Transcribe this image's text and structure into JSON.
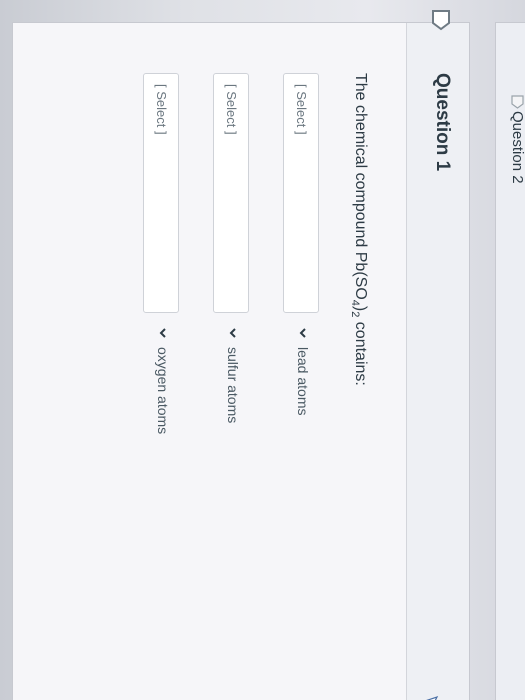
{
  "question1": {
    "title": "Question 1",
    "prompt_prefix": "The chemical compound Pb(SO",
    "prompt_sub1": "4",
    "prompt_mid": ")",
    "prompt_sub2": "2",
    "prompt_suffix": " contains:",
    "rows": [
      {
        "select_value": "[ Select ]",
        "answer": "lead atoms"
      },
      {
        "select_value": "[ Select ]",
        "answer": "sulfur atoms"
      },
      {
        "select_value": "[ Select ]",
        "answer": "oxygen atoms"
      }
    ]
  },
  "question2": {
    "title": "Question 2"
  },
  "icons": {
    "flag": "flag-icon",
    "chevron": "chevron-down-icon",
    "cursor": "cursor-icon"
  },
  "colors": {
    "text": "#2d3b45",
    "card": "#f6f6f9",
    "border": "#c7c9d0"
  }
}
